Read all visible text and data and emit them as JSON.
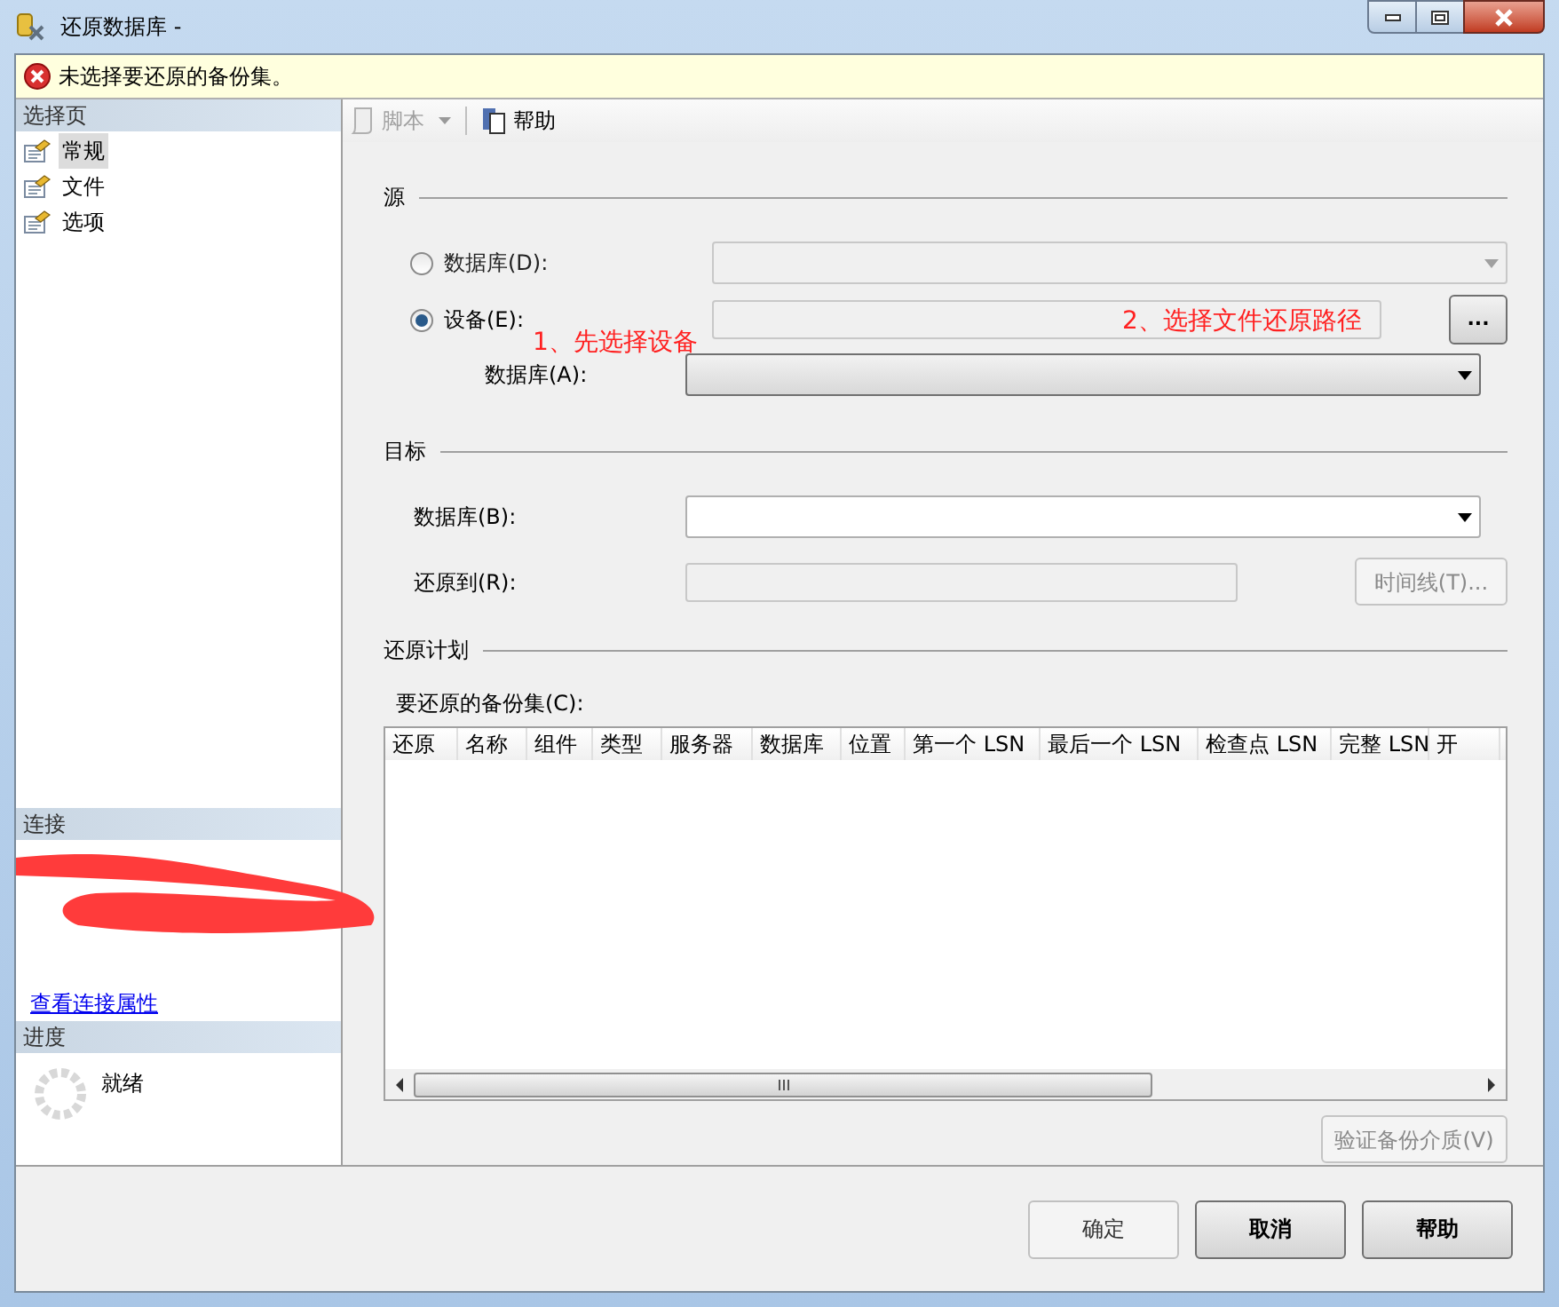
{
  "window": {
    "title": "还原数据库 -"
  },
  "error_bar": {
    "message": "未选择要还原的备份集。"
  },
  "sidebar": {
    "select_page": {
      "header": "选择页",
      "items": [
        {
          "label": "常规",
          "selected": true
        },
        {
          "label": "文件",
          "selected": false
        },
        {
          "label": "选项",
          "selected": false
        }
      ]
    },
    "connection": {
      "header": "连接",
      "link": "查看连接属性"
    },
    "progress": {
      "header": "进度",
      "status": "就绪"
    }
  },
  "toolbar": {
    "items": [
      {
        "label": "脚本",
        "kind": "dropdown",
        "disabled": true
      },
      {
        "label": "帮助",
        "kind": "button",
        "disabled": false
      }
    ]
  },
  "source": {
    "title": "源",
    "options": [
      {
        "label": "数据库(D):",
        "selected": false
      },
      {
        "label": "设备(E):",
        "selected": true
      }
    ],
    "browse_button": "...",
    "database_label": "数据库(A):"
  },
  "target": {
    "title": "目标",
    "database_label": "数据库(B):",
    "restore_to_label": "还原到(R):",
    "timeline_button": {
      "label": "时间线(T)...",
      "disabled": true
    }
  },
  "plan": {
    "title": "还原计划",
    "backup_sets_label": "要还原的备份集(C):",
    "table": {
      "columns": [
        "还原",
        "名称",
        "组件",
        "类型",
        "服务器",
        "数据库",
        "位置",
        "第一个 LSN",
        "最后一个 LSN",
        "检查点 LSN",
        "完整 LSN",
        "开"
      ]
    }
  },
  "verify_button": {
    "label": "验证备份介质(V)",
    "disabled": true
  },
  "buttons": [
    {
      "label": "确定",
      "disabled": true
    },
    {
      "label": "取消",
      "disabled": false
    },
    {
      "label": "帮助",
      "disabled": false
    }
  ],
  "annotations": [
    "1、先选择设备",
    "2、选择文件还原路径"
  ]
}
